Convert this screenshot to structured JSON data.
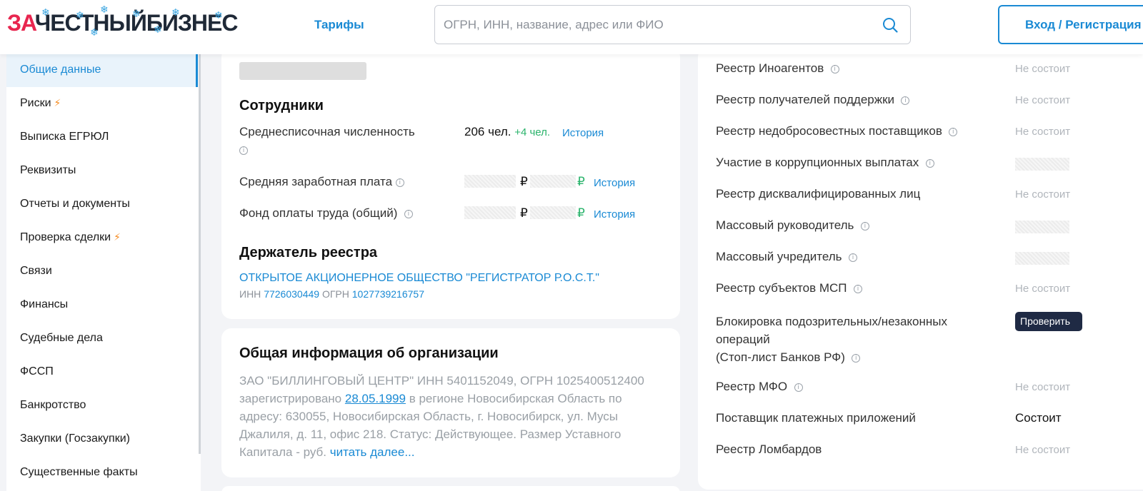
{
  "header": {
    "logo_prefix": "ЗА",
    "logo_main": "ЧЕСТНЫЙБИЗНЕС",
    "tariffs": "Тарифы",
    "search_placeholder": "ОГРН, ИНН, название, адрес или ФИО",
    "login": "Вход / Регистрация"
  },
  "sidebar": {
    "items": [
      {
        "label": "Общие данные",
        "active": true
      },
      {
        "label": "Риски",
        "bolt": true
      },
      {
        "label": "Выписка ЕГРЮЛ"
      },
      {
        "label": "Реквизиты"
      },
      {
        "label": "Отчеты и документы"
      },
      {
        "label": "Проверка сделки",
        "bolt": true
      },
      {
        "label": "Связи"
      },
      {
        "label": "Финансы"
      },
      {
        "label": "Судебные дела"
      },
      {
        "label": "ФССП"
      },
      {
        "label": "Банкротство"
      },
      {
        "label": "Закупки (Госзакупки)"
      },
      {
        "label": "Существенные факты"
      }
    ],
    "bolt_glyph": "⚡"
  },
  "employees": {
    "title": "Сотрудники",
    "avg_count_label": "Среднесписочная численность",
    "avg_count_value": "206 чел.",
    "avg_count_delta": "+4 чел.",
    "history": "История",
    "avg_salary_label": "Средняя заработная плата",
    "payroll_label": "Фонд оплаты труда (общий)",
    "rub": "₽"
  },
  "registry_holder": {
    "title": "Держатель реестра",
    "name": "ОТКРЫТОЕ АКЦИОНЕРНОЕ ОБЩЕСТВО \"РЕГИСТРАТОР Р.О.С.Т.\"",
    "inn_label": "ИНН",
    "inn": "7726030449",
    "ogrn_label": "ОГРН",
    "ogrn": "1027739216757"
  },
  "general_info": {
    "title": "Общая информация об организации",
    "text_before_date": "ЗАО \"БИЛЛИНГОВЫЙ ЦЕНТР\" ИНН 5401152049, ОГРН 1025400512400 зарегистрировано ",
    "date": "28.05.1999",
    "text_after_date": " в регионе Новосибирская Область по адресу: 630055, Новосибирская Область, г. Новосибирск, ул. Мусы Джалиля, д. 11, офис 218. Статус: Действующее. Размер Уставного Капитала - руб. ",
    "read_more": "читать далее..."
  },
  "registries": {
    "not_member": "Не состоит",
    "member": "Состоит",
    "check": "Проверить",
    "rows": [
      {
        "label": "Реестр Иноагентов"
      },
      {
        "label": "Реестр получателей поддержки"
      },
      {
        "label": "Реестр недобросовестных поставщиков"
      },
      {
        "label": "Участие в коррупционных выплатах"
      },
      {
        "label": "Реестр дисквалифицированных лиц"
      },
      {
        "label": "Массовый руководитель"
      },
      {
        "label": "Массовый учредитель"
      },
      {
        "label": "Реестр субъектов МСП"
      },
      {
        "label_line1": "Блокировка подозрительных/незаконных",
        "label_line2": "операций",
        "label_line3": "(Стоп-лист Банков РФ)"
      },
      {
        "label": "Реестр МФО"
      },
      {
        "label": "Поставщик платежных приложений"
      },
      {
        "label": "Реестр Ломбардов"
      }
    ]
  },
  "colors": {
    "accent": "#1a8ad4",
    "logo_red": "#e8264f",
    "green": "#2ab36b",
    "bolt": "#f58a1f",
    "dark_button": "#1f2a44"
  }
}
